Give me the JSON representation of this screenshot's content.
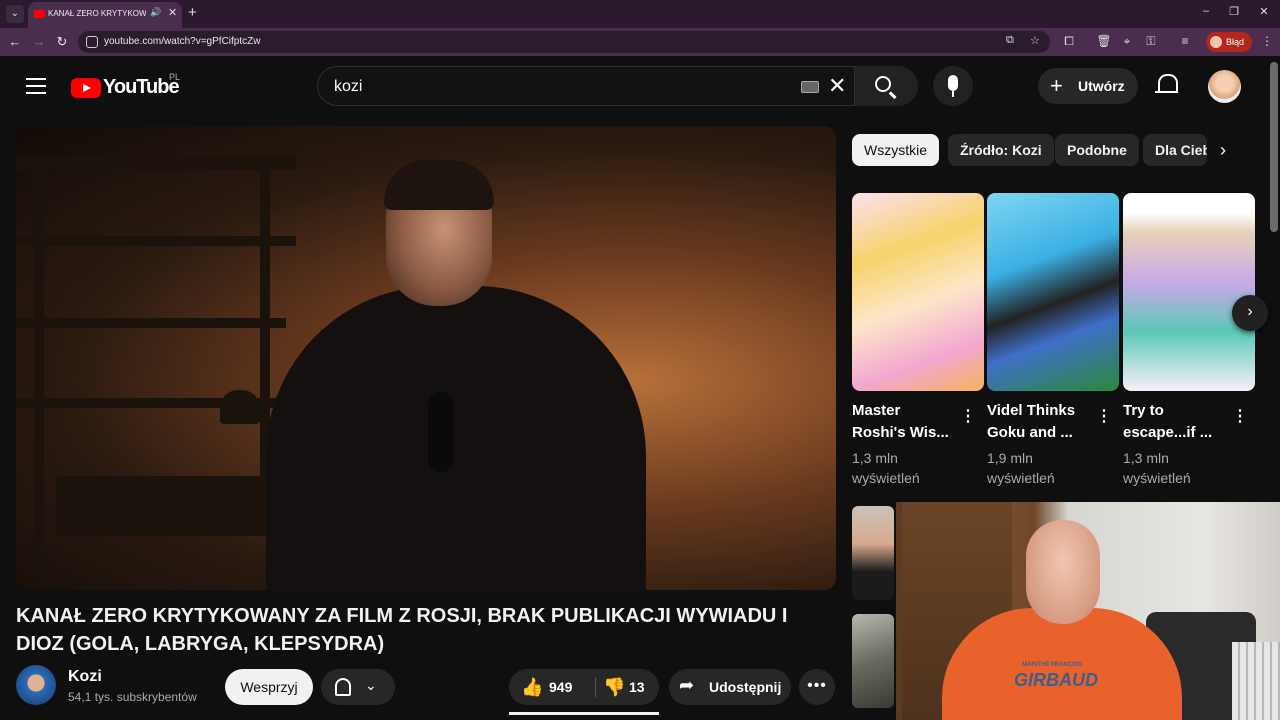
{
  "browser": {
    "tab_title": "KANAŁ ZERO KRYTYKOWAN",
    "url": "youtube.com/watch?v=gPfCifptcZw",
    "profile_label": "Błąd",
    "new_tab_symbol": "+",
    "win_min": "–",
    "win_max": "❐",
    "win_close": "✕",
    "tab_audio": "🔊",
    "tab_close": "✕",
    "tab_menu": "⌄"
  },
  "header": {
    "logo_text": "YouTube",
    "country": "PL",
    "search_value": "kozi",
    "clear_symbol": "✕",
    "create_label": "Utwórz",
    "create_symbol": "+"
  },
  "video": {
    "title": "KANAŁ ZERO KRYTYKOWANY ZA FILM Z ROSJI, BRAK PUBLIKACJI WYWIADU I DIOZ (GOLA, LABRYGA, KLEPSYDRA)",
    "channel_name": "Kozi",
    "channel_subs": "54,1 tys. subskrybentów",
    "support_label": "Wesprzyj",
    "likes": "949",
    "dislikes": "13",
    "share_label": "Udostępnij",
    "more_symbol": "•••",
    "like_symbol": "👍",
    "dislike_symbol": "👎",
    "share_symbol": "➦",
    "chevron_symbol": "⌄"
  },
  "sidebar": {
    "chips": [
      "Wszystkie",
      "Źródło: Kozi",
      "Podobne",
      "Dla Ciebie"
    ],
    "chips_next_symbol": "›",
    "shorts": [
      {
        "title": "Master Roshi's Wis...",
        "views": "1,3 mln wyświetleń"
      },
      {
        "title": "Videl Thinks Goku and ...",
        "views": "1,9 mln wyświetleń"
      },
      {
        "title": "Try to escape...if ...",
        "views": "1,3 mln wyświetleń"
      }
    ],
    "shorts_next_symbol": "›",
    "short_more_symbol": "⋮"
  },
  "webcam": {
    "shirt_brand": "GIRBAUD",
    "shirt_small": "MARITHE FRANCOIS"
  }
}
